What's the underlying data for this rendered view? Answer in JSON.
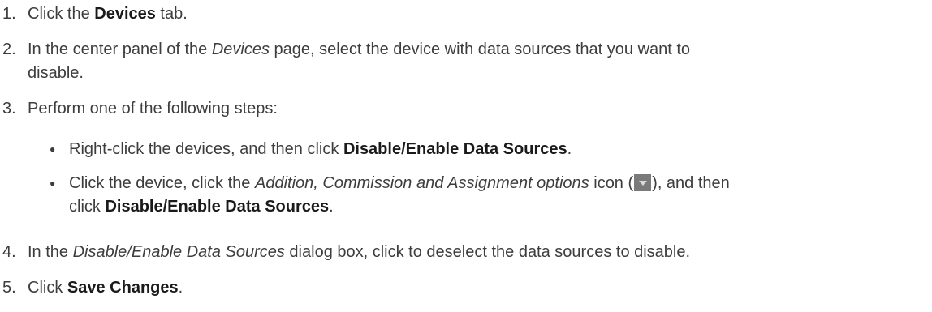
{
  "steps": [
    {
      "number": "1.",
      "pre": "Click the ",
      "bold": "Devices",
      "post": " tab."
    },
    {
      "number": "2.",
      "pre": "In the center panel of the ",
      "italic": "Devices",
      "line1_post": " page, select the device with data sources that you want to",
      "line2": "disable."
    },
    {
      "number": "3.",
      "text": "Perform one of the following steps:",
      "options": [
        {
          "pre": "Right-click the devices, and then click ",
          "bold": "Disable/Enable Data Sources",
          "post": "."
        },
        {
          "pre": "Click the device, click the ",
          "italic": "Addition, Commission and Assignment options",
          "mid": " icon (",
          "icon": "dropdown-arrow-icon",
          "after_icon": "), and then",
          "line2_pre": "click ",
          "line2_bold": "Disable/Enable Data Sources",
          "line2_post": "."
        }
      ]
    },
    {
      "number": "4.",
      "pre": "In the ",
      "italic": "Disable/Enable Data Sources",
      "post": " dialog box, click to deselect the data sources to disable."
    },
    {
      "number": "5.",
      "pre": "Click ",
      "bold": "Save Changes",
      "post": "."
    }
  ],
  "colors": {
    "text": "#3d3d3d",
    "icon_bg": "#7a7a7a"
  }
}
